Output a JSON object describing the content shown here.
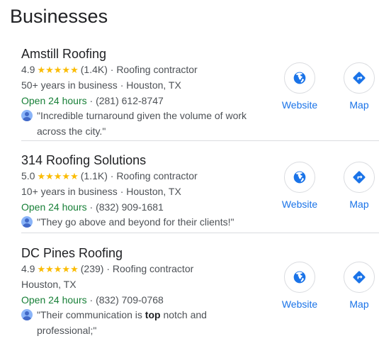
{
  "heading": "Businesses",
  "businesses": [
    {
      "name": "Amstill Roofing",
      "rating": "4.9",
      "stars": "★★★★★",
      "reviews": "(1.4K)",
      "category": "· Roofing contractor",
      "details": "50+ years in business · Houston, TX",
      "hours": "Open 24 hours",
      "phone": "· (281) 612-8747",
      "review": "\"Incredible turnaround given the volume of work across the city.\"",
      "website_label": "Website",
      "map_label": "Map"
    },
    {
      "name": "314 Roofing Solutions",
      "rating": "5.0",
      "stars": "★★★★★",
      "reviews": "(1.1K)",
      "category": "· Roofing contractor",
      "details": "10+ years in business · Houston, TX",
      "hours": "Open 24 hours",
      "phone": "· (832) 909-1681",
      "review": "\"They go above and beyond for their clients!\"",
      "website_label": "Website",
      "map_label": "Map"
    },
    {
      "name": "DC Pines Roofing",
      "rating": "4.9",
      "stars": "★★★★★",
      "reviews": "(239)",
      "category": "· Roofing contractor",
      "details": "Houston, TX",
      "hours": "Open 24 hours",
      "phone": "· (832) 709-0768",
      "review_before": "\"Their communication is ",
      "review_bold": "top",
      "review_after": " notch and professional;\"",
      "website_label": "Website",
      "map_label": "Map"
    }
  ],
  "colors": {
    "link_blue": "#1a73e8",
    "star_yellow": "#fbbc04",
    "open_green": "#188038",
    "secondary_text": "#4d5156"
  },
  "icons": {
    "website": "globe-icon",
    "map": "directions-icon",
    "reviewer": "person-avatar-icon"
  }
}
